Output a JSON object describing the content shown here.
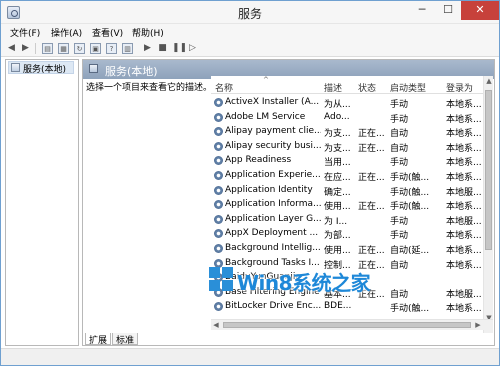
{
  "window": {
    "title": "服务"
  },
  "titlebar": {
    "min": "─",
    "max": "☐",
    "close": "✕"
  },
  "menu": [
    "文件(F)",
    "操作(A)",
    "查看(V)",
    "帮助(H)"
  ],
  "tree": {
    "item": "服务(本地)"
  },
  "content": {
    "header": "服务(本地)",
    "description": "选择一个项目来查看它的描述。"
  },
  "columns": {
    "name": "名称",
    "desc": "描述",
    "status": "状态",
    "type": "启动类型",
    "logon": "登录为"
  },
  "services": [
    {
      "name": "ActiveX Installer (A...",
      "desc": "为从...",
      "status": "",
      "type": "手动",
      "logon": "本地系..."
    },
    {
      "name": "Adobe LM Service",
      "desc": "Ado...",
      "status": "",
      "type": "手动",
      "logon": "本地系..."
    },
    {
      "name": "Alipay payment clie...",
      "desc": "为支...",
      "status": "正在...",
      "type": "自动",
      "logon": "本地系..."
    },
    {
      "name": "Alipay security busi...",
      "desc": "为支...",
      "status": "正在...",
      "type": "自动",
      "logon": "本地系..."
    },
    {
      "name": "App Readiness",
      "desc": "当用...",
      "status": "",
      "type": "手动",
      "logon": "本地系..."
    },
    {
      "name": "Application Experie...",
      "desc": "在应...",
      "status": "正在...",
      "type": "手动(触...",
      "logon": "本地系..."
    },
    {
      "name": "Application Identity",
      "desc": "确定...",
      "status": "",
      "type": "手动(触...",
      "logon": "本地服..."
    },
    {
      "name": "Application Informa...",
      "desc": "使用...",
      "status": "正在...",
      "type": "手动(触...",
      "logon": "本地系..."
    },
    {
      "name": "Application Layer G...",
      "desc": "为 I...",
      "status": "",
      "type": "手动",
      "logon": "本地服..."
    },
    {
      "name": "AppX Deployment ...",
      "desc": "为部...",
      "status": "",
      "type": "手动",
      "logon": "本地系..."
    },
    {
      "name": "Background Intellig...",
      "desc": "使用...",
      "status": "正在...",
      "type": "自动(延...",
      "logon": "本地系..."
    },
    {
      "name": "Background Tasks I...",
      "desc": "控制...",
      "status": "正在...",
      "type": "自动",
      "logon": "本地系..."
    },
    {
      "name": "BaiduYunGuanjia",
      "desc": "",
      "status": "",
      "type": "",
      "logon": ""
    },
    {
      "name": "Base Filtering Engine",
      "desc": "基本...",
      "status": "正在...",
      "type": "自动",
      "logon": "本地服..."
    },
    {
      "name": "BitLocker Drive Enc...",
      "desc": "BDE...",
      "status": "",
      "type": "手动(触...",
      "logon": "本地系..."
    }
  ],
  "tabs": [
    "扩展",
    "标准"
  ],
  "watermark": {
    "text": "Win8系统之家"
  }
}
